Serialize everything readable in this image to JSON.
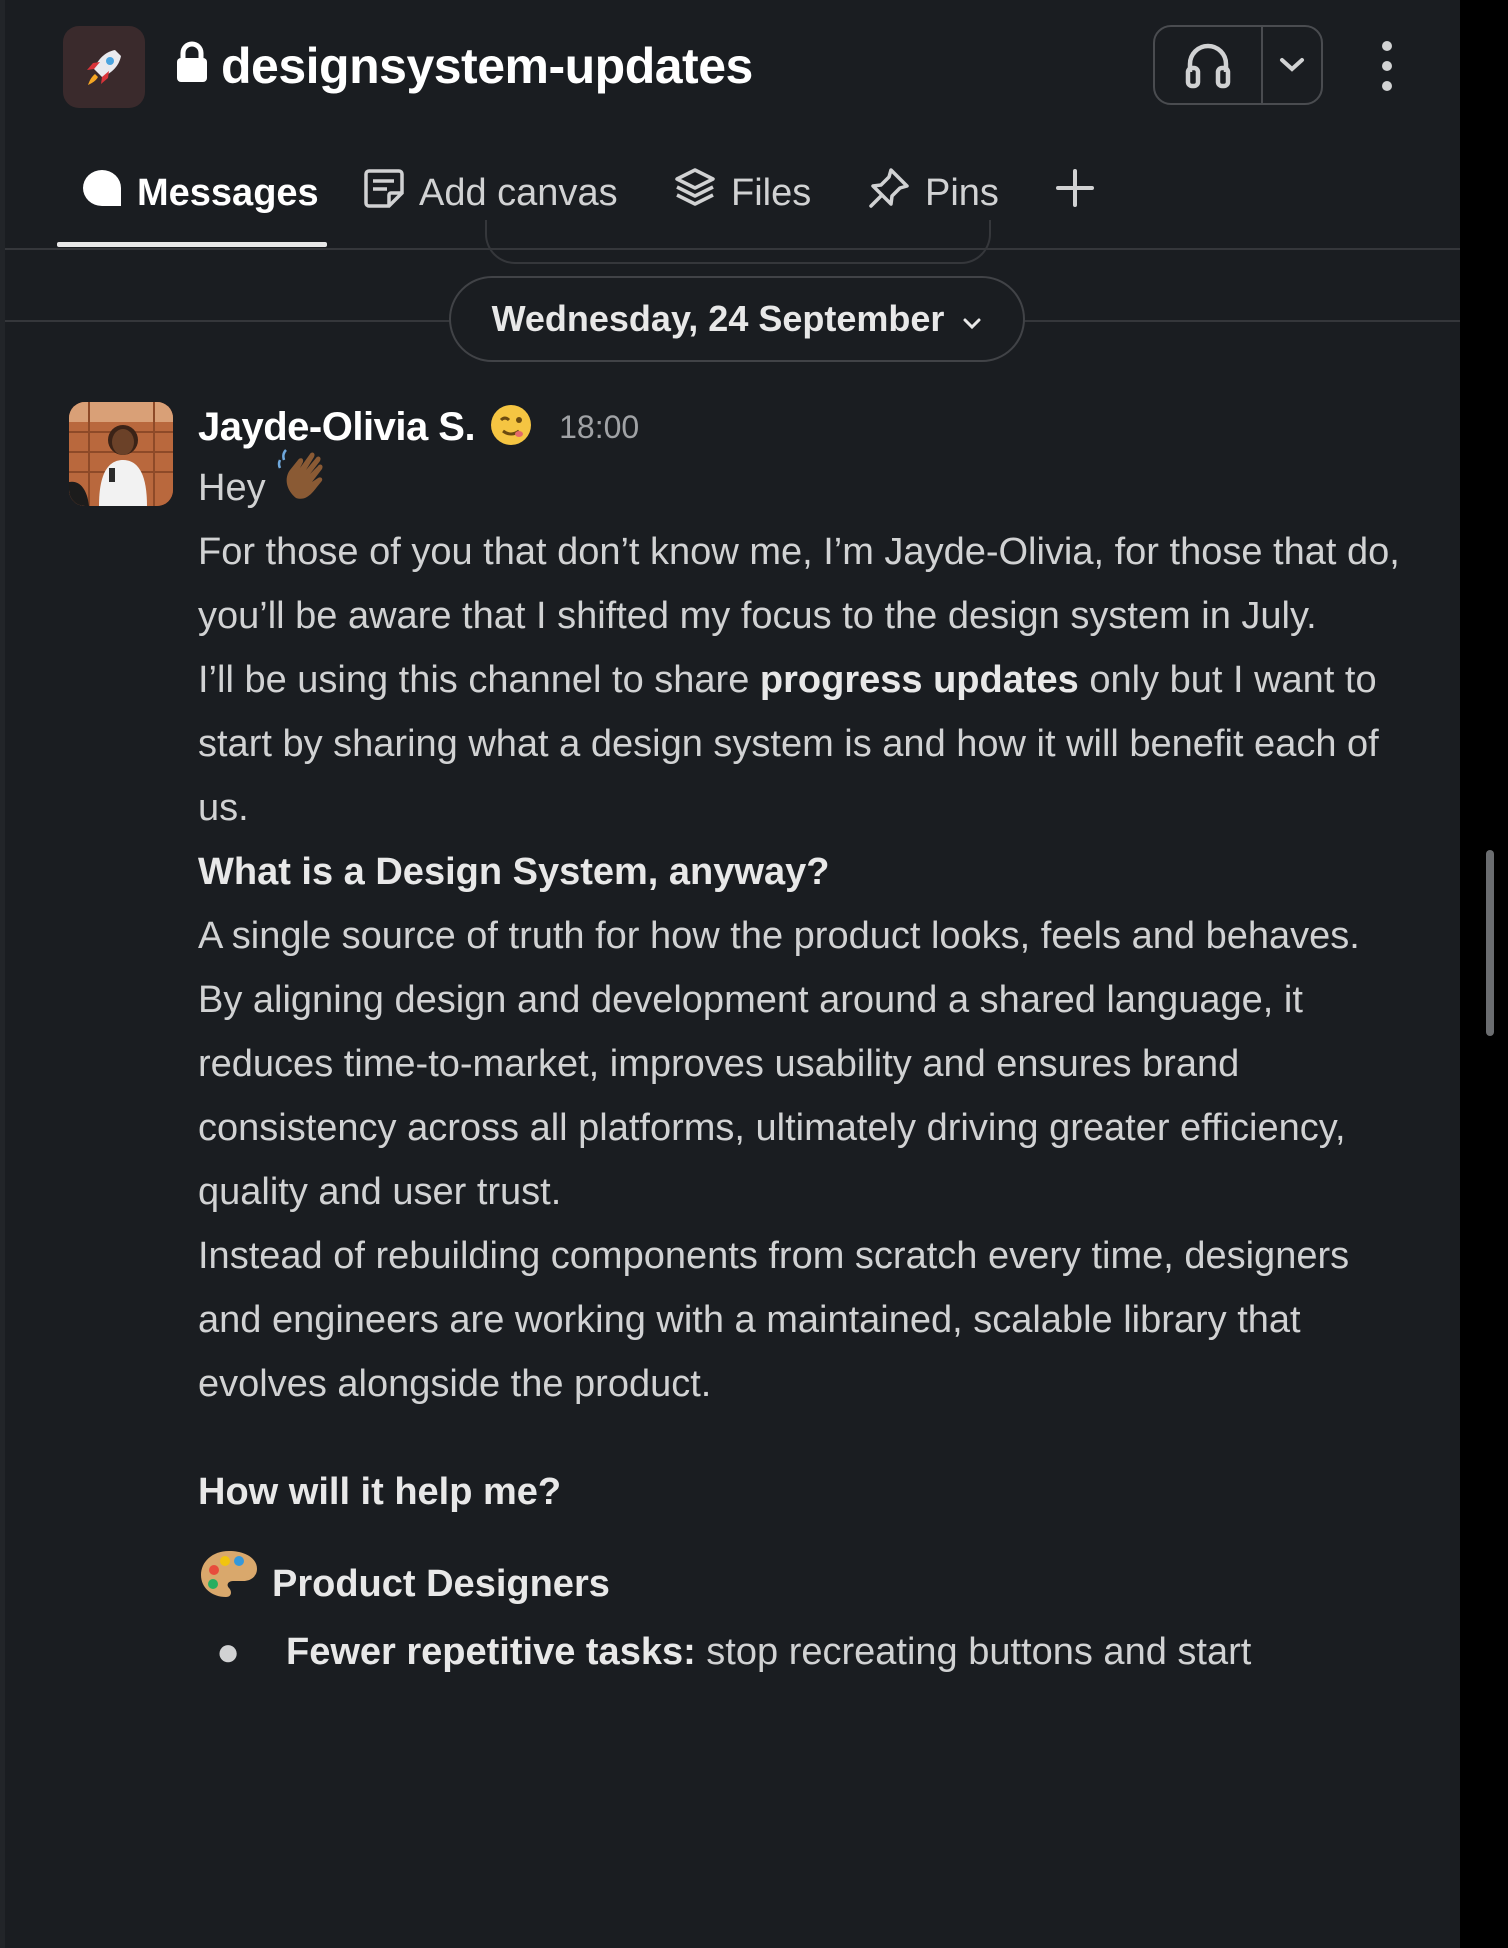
{
  "header": {
    "channel_name": "designsystem-updates",
    "channel_icon": "rocket-icon",
    "private_icon": "lock-icon",
    "huddle_icon": "headphones-icon",
    "huddle_menu_icon": "chevron-down-icon",
    "more_icon": "kebab-menu-icon"
  },
  "tabs": [
    {
      "label": "Messages",
      "icon": "message-bubble-icon",
      "active": true
    },
    {
      "label": "Add canvas",
      "icon": "canvas-icon",
      "active": false
    },
    {
      "label": "Files",
      "icon": "layers-icon",
      "active": false
    },
    {
      "label": "Pins",
      "icon": "pin-icon",
      "active": false
    }
  ],
  "add_tab_icon": "plus-icon",
  "date_divider": {
    "label": "Wednesday, 24 September"
  },
  "message": {
    "author": "Jayde-Olivia S.",
    "status_emoji": "face-emoji",
    "time": "18:00",
    "greeting": "Hey",
    "greeting_emoji": "waving-hand-emoji",
    "p1": "For those of you that don’t know me, I’m Jayde-Olivia, for those that do, you’ll be aware that I shifted my focus to the design system in July.",
    "p2_before": "I’ll be using this channel to share ",
    "p2_bold": "progress updates",
    "p2_after": " only but I want to start by sharing what a design system is and how it will benefit each of us.",
    "h1": "What is a Design System, anyway?",
    "p3": "A single source of truth for how the product looks, feels and behaves.",
    "p4": "By aligning design and development around a shared language, it reduces time-to-market, improves usability and ensures brand consistency across all platforms, ultimately driving greater efficiency, quality and user trust.",
    "p5": "Instead of rebuilding components from scratch every time, designers and engineers are working with a maintained, scalable library that evolves alongside the product.",
    "h2": "How will it help me?",
    "role_emoji": "artist-palette-emoji",
    "role": "Product Designers",
    "bullet_bold": "Fewer repetitive tasks:",
    "bullet_text": " stop recreating buttons and start"
  }
}
